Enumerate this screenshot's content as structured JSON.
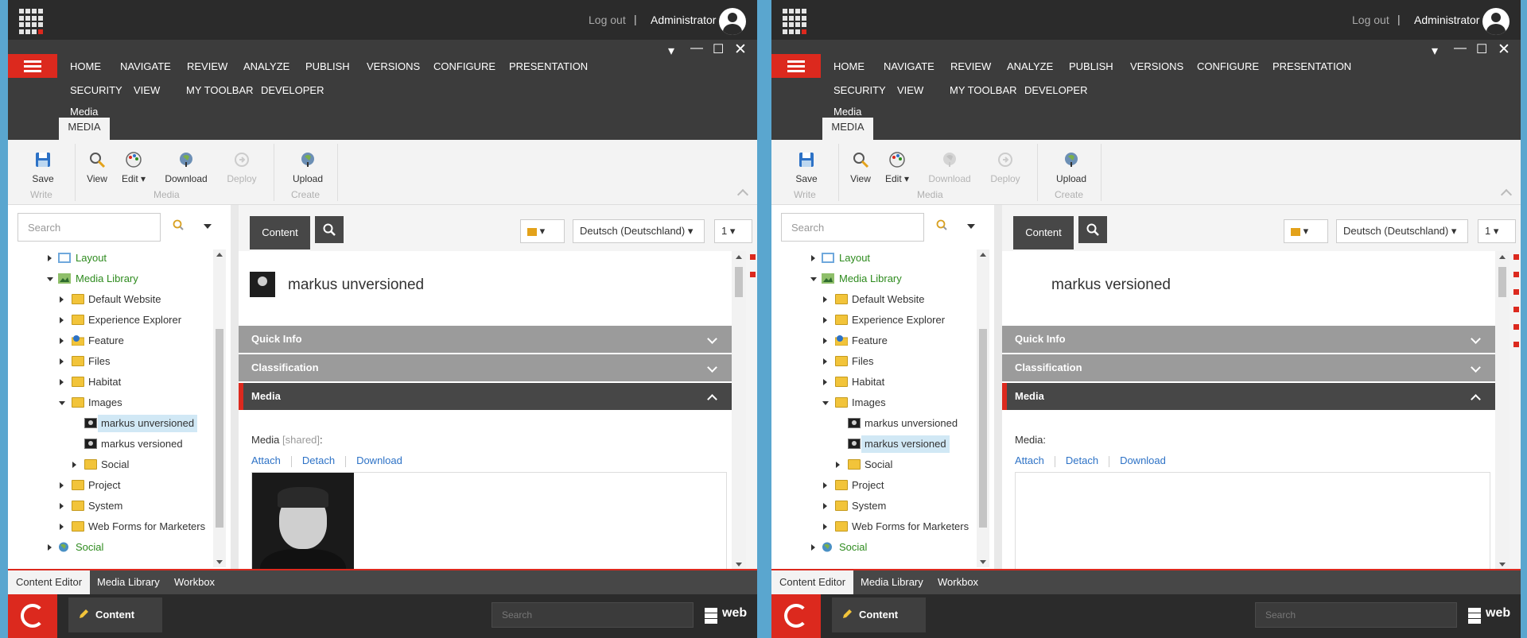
{
  "app": {
    "logout": "Log out",
    "separator": "|",
    "user": "Administrator",
    "ribbon_tabs_row1": [
      "HOME",
      "NAVIGATE",
      "REVIEW",
      "ANALYZE",
      "PUBLISH",
      "VERSIONS",
      "CONFIGURE",
      "PRESENTATION"
    ],
    "ribbon_tabs_row2": [
      "SECURITY",
      "VIEW",
      "MY TOOLBAR",
      "DEVELOPER"
    ],
    "context_label": "Media",
    "context_tab": "MEDIA",
    "search_placeholder": "Search",
    "content_tab": "Content",
    "language": "Deutsch (Deutschland)",
    "version": "1",
    "sections": {
      "quick_info": "Quick Info",
      "classification": "Classification",
      "media": "Media"
    },
    "links": {
      "attach": "Attach",
      "detach": "Detach",
      "download": "Download"
    },
    "bottom_tabs": [
      "Content Editor",
      "Media Library",
      "Workbox"
    ],
    "taskbar": {
      "app": "Content Editor",
      "search_placeholder": "Search",
      "database": "web"
    },
    "colors": {
      "accent": "#dc291e",
      "link": "#2d72c6",
      "tree_green": "#2e8b1e"
    }
  },
  "panes": [
    {
      "toolbar": {
        "save": "Save",
        "write": "Write",
        "view": "View",
        "edit": "Edit",
        "download": "Download",
        "deploy": "Deploy",
        "media": "Media",
        "upload": "Upload",
        "create": "Create",
        "download_disabled": false
      },
      "tree": [
        "Layout",
        "Media Library",
        "Default Website",
        "Experience Explorer",
        "Feature",
        "Files",
        "Habitat",
        "Images",
        "markus unversioned",
        "markus versioned",
        "Social",
        "Project",
        "System",
        "Web Forms for Marketers",
        "Social"
      ],
      "item_title": "markus unversioned",
      "field_label": "Media",
      "field_shared": "[shared]",
      "field_colon": ":"
    },
    {
      "toolbar": {
        "save": "Save",
        "write": "Write",
        "view": "View",
        "edit": "Edit",
        "download": "Download",
        "deploy": "Deploy",
        "media": "Media",
        "upload": "Upload",
        "create": "Create",
        "download_disabled": true
      },
      "tree": [
        "Layout",
        "Media Library",
        "Default Website",
        "Experience Explorer",
        "Feature",
        "Files",
        "Habitat",
        "Images",
        "markus unversioned",
        "markus versioned",
        "Social",
        "Project",
        "System",
        "Web Forms for Marketers",
        "Social"
      ],
      "item_title": "markus versioned",
      "field_label": "Media",
      "field_shared": "",
      "field_colon": ":"
    }
  ]
}
